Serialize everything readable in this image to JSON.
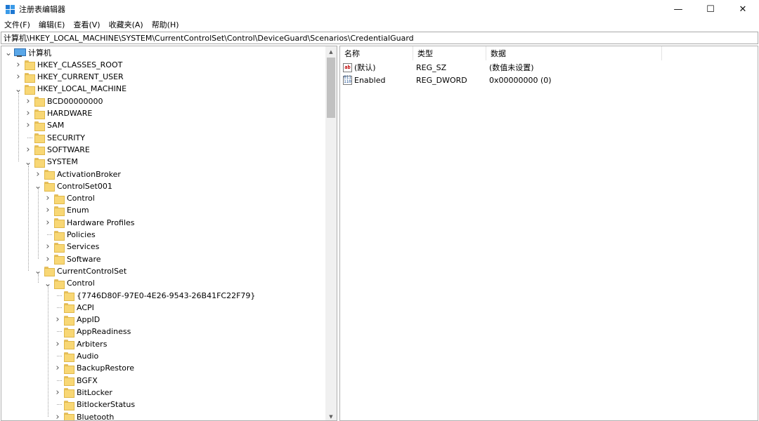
{
  "window": {
    "title": "注册表编辑器"
  },
  "controls": {
    "minimize": "—",
    "maximize": "☐",
    "close": "✕"
  },
  "menu": [
    "文件(F)",
    "编辑(E)",
    "查看(V)",
    "收藏夹(A)",
    "帮助(H)"
  ],
  "address": "计算机\\HKEY_LOCAL_MACHINE\\SYSTEM\\CurrentControlSet\\Control\\DeviceGuard\\Scenarios\\CredentialGuard",
  "tree": [
    {
      "label": "计算机",
      "level": 0,
      "state": "expanded",
      "icon": "computer-icon"
    },
    {
      "label": "HKEY_CLASSES_ROOT",
      "level": 1,
      "state": "collapsed",
      "icon": "folder-icon"
    },
    {
      "label": "HKEY_CURRENT_USER",
      "level": 1,
      "state": "collapsed",
      "icon": "folder-icon"
    },
    {
      "label": "HKEY_LOCAL_MACHINE",
      "level": 1,
      "state": "expanded",
      "icon": "folder-icon"
    },
    {
      "label": "BCD00000000",
      "level": 2,
      "state": "collapsed",
      "icon": "folder-icon"
    },
    {
      "label": "HARDWARE",
      "level": 2,
      "state": "collapsed",
      "icon": "folder-icon"
    },
    {
      "label": "SAM",
      "level": 2,
      "state": "collapsed",
      "icon": "folder-icon"
    },
    {
      "label": "SECURITY",
      "level": 2,
      "state": "none",
      "icon": "folder-icon"
    },
    {
      "label": "SOFTWARE",
      "level": 2,
      "state": "collapsed",
      "icon": "folder-icon"
    },
    {
      "label": "SYSTEM",
      "level": 2,
      "state": "expanded",
      "icon": "folder-icon"
    },
    {
      "label": "ActivationBroker",
      "level": 3,
      "state": "collapsed",
      "icon": "folder-icon"
    },
    {
      "label": "ControlSet001",
      "level": 3,
      "state": "expanded",
      "icon": "folder-icon"
    },
    {
      "label": "Control",
      "level": 4,
      "state": "collapsed",
      "icon": "folder-icon"
    },
    {
      "label": "Enum",
      "level": 4,
      "state": "collapsed",
      "icon": "folder-icon"
    },
    {
      "label": "Hardware Profiles",
      "level": 4,
      "state": "collapsed",
      "icon": "folder-icon"
    },
    {
      "label": "Policies",
      "level": 4,
      "state": "none",
      "icon": "folder-icon"
    },
    {
      "label": "Services",
      "level": 4,
      "state": "collapsed",
      "icon": "folder-icon"
    },
    {
      "label": "Software",
      "level": 4,
      "state": "collapsed",
      "icon": "folder-icon"
    },
    {
      "label": "CurrentControlSet",
      "level": 3,
      "state": "expanded",
      "icon": "folder-icon"
    },
    {
      "label": "Control",
      "level": 4,
      "state": "expanded",
      "icon": "folder-icon"
    },
    {
      "label": "{7746D80F-97E0-4E26-9543-26B41FC22F79}",
      "level": 5,
      "state": "none",
      "icon": "folder-icon"
    },
    {
      "label": "ACPI",
      "level": 5,
      "state": "none",
      "icon": "folder-icon"
    },
    {
      "label": "AppID",
      "level": 5,
      "state": "collapsed",
      "icon": "folder-icon"
    },
    {
      "label": "AppReadiness",
      "level": 5,
      "state": "none",
      "icon": "folder-icon"
    },
    {
      "label": "Arbiters",
      "level": 5,
      "state": "collapsed",
      "icon": "folder-icon"
    },
    {
      "label": "Audio",
      "level": 5,
      "state": "none",
      "icon": "folder-icon"
    },
    {
      "label": "BackupRestore",
      "level": 5,
      "state": "collapsed",
      "icon": "folder-icon"
    },
    {
      "label": "BGFX",
      "level": 5,
      "state": "none",
      "icon": "folder-icon"
    },
    {
      "label": "BitLocker",
      "level": 5,
      "state": "collapsed",
      "icon": "folder-icon"
    },
    {
      "label": "BitlockerStatus",
      "level": 5,
      "state": "none",
      "icon": "folder-icon"
    },
    {
      "label": "Bluetooth",
      "level": 5,
      "state": "collapsed",
      "icon": "folder-icon"
    }
  ],
  "list": {
    "columns": [
      "名称",
      "类型",
      "数据"
    ],
    "rows": [
      {
        "icon": "string-value-icon",
        "name": "(默认)",
        "type": "REG_SZ",
        "data": "(数值未设置)"
      },
      {
        "icon": "dword-value-icon",
        "name": "Enabled",
        "type": "REG_DWORD",
        "data": "0x00000000 (0)"
      }
    ]
  }
}
